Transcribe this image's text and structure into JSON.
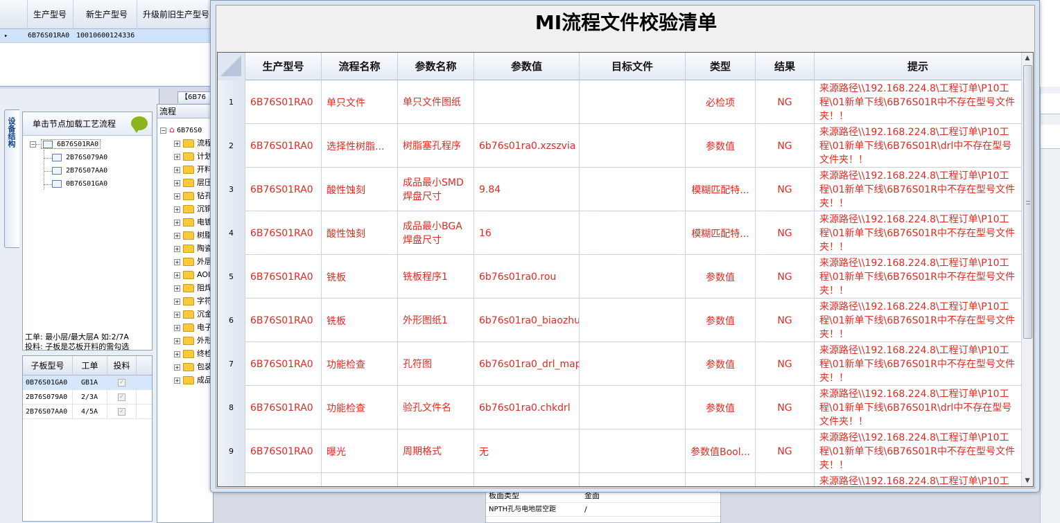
{
  "top_grid": {
    "headers": [
      "生产型号",
      "新生产型号",
      "升级前旧生产型号"
    ],
    "row": [
      "6B76S01RA0",
      "10010600124336"
    ]
  },
  "left": {
    "vertical_tab": "设备结构",
    "tree_header": "单击节点加载工艺流程",
    "root_node": "6B76S01RA0",
    "child_nodes": [
      "2B76S079A0",
      "2B76S07AA0",
      "0B76S01GA0"
    ],
    "info_line1": "工单: 最小层/最大层A 如:2/7A",
    "info_line2": "投料: 子板是芯板开料的需勾选",
    "sub_headers": [
      "子板型号",
      "工单",
      "投料"
    ],
    "sub_rows": [
      {
        "model": "0B76S01GA0",
        "order": "GB1A",
        "check": "✓"
      },
      {
        "model": "2B76S079A0",
        "order": "2/3A",
        "check": "✓"
      },
      {
        "model": "2B76S07AA0",
        "order": "4/5A",
        "check": "✓"
      }
    ]
  },
  "middle": {
    "tab_label": "【6B76",
    "header": "流程",
    "root": "6B76S0",
    "folders": [
      "流程",
      "计划",
      "开料",
      "层压",
      "钻孔",
      "沉铜",
      "电镀",
      "树脂",
      "陶瓷",
      "外层",
      "AOI",
      "阻焊",
      "字符",
      "沉金",
      "电子",
      "外形",
      "终检",
      "包装",
      "成品"
    ]
  },
  "bottom_grid": {
    "rows": [
      {
        "name": "板面类型",
        "value": "金面"
      },
      {
        "name": "NPTH孔与电地层空距",
        "value": "/"
      }
    ]
  },
  "dialog": {
    "title": "MI流程文件校验清单",
    "columns": [
      "生产型号",
      "流程名称",
      "参数名称",
      "参数值",
      "目标文件",
      "类型",
      "结果",
      "提示"
    ],
    "rows": [
      {
        "idx": "1",
        "model": "6B76S01RA0",
        "process": "单只文件",
        "param": "单只文件图纸",
        "value": "",
        "target": "",
        "type": "必检项",
        "result": "NG",
        "tip": "来源路径\\\\192.168.224.8\\工程订单\\P10工程\\01新单下线\\6B76S01R中不存在型号文件夹！！"
      },
      {
        "idx": "2",
        "model": "6B76S01RA0",
        "process": "选择性树脂...",
        "param": "树脂塞孔程序",
        "value": "6b76s01ra0.xzszvia",
        "target": "",
        "type": "参数值",
        "result": "NG",
        "tip": "来源路径\\\\192.168.224.8\\工程订单\\P10工程\\01新单下线\\6B76S01R\\drl中不存在型号文件夹！！"
      },
      {
        "idx": "3",
        "model": "6B76S01RA0",
        "process": "酸性蚀刻",
        "param": "成品最小SMD焊盘尺寸",
        "value": "9.84",
        "target": "",
        "type": "模糊匹配特...",
        "result": "NG",
        "tip": "来源路径\\\\192.168.224.8\\工程订单\\P10工程\\01新单下线\\6B76S01R中不存在型号文件夹！！"
      },
      {
        "idx": "4",
        "model": "6B76S01RA0",
        "process": "酸性蚀刻",
        "param": "成品最小BGA焊盘尺寸",
        "value": "16",
        "target": "",
        "type": "模糊匹配特...",
        "result": "NG",
        "tip": "来源路径\\\\192.168.224.8\\工程订单\\P10工程\\01新单下线\\6B76S01R中不存在型号文件夹！！"
      },
      {
        "idx": "5",
        "model": "6B76S01RA0",
        "process": "铣板",
        "param": "铣板程序1",
        "value": "6b76s01ra0.rou",
        "target": "",
        "type": "参数值",
        "result": "NG",
        "tip": "来源路径\\\\192.168.224.8\\工程订单\\P10工程\\01新单下线\\6B76S01R中不存在型号文件夹！！"
      },
      {
        "idx": "6",
        "model": "6B76S01RA0",
        "process": "铣板",
        "param": "外形图纸1",
        "value": "6b76s01ra0_biaozhu",
        "target": "",
        "type": "参数值",
        "result": "NG",
        "tip": "来源路径\\\\192.168.224.8\\工程订单\\P10工程\\01新单下线\\6B76S01R中不存在型号文件夹！！"
      },
      {
        "idx": "7",
        "model": "6B76S01RA0",
        "process": "功能检查",
        "param": "孔符图",
        "value": "6b76s01ra0_drl_map",
        "target": "",
        "type": "参数值",
        "result": "NG",
        "tip": "来源路径\\\\192.168.224.8\\工程订单\\P10工程\\01新单下线\\6B76S01R中不存在型号文件夹！！"
      },
      {
        "idx": "8",
        "model": "6B76S01RA0",
        "process": "功能检查",
        "param": "验孔文件名",
        "value": "6b76s01ra0.chkdrl",
        "target": "",
        "type": "参数值",
        "result": "NG",
        "tip": "来源路径\\\\192.168.224.8\\工程订单\\P10工程\\01新单下线\\6B76S01R\\drl中不存在型号文件夹！！"
      },
      {
        "idx": "9",
        "model": "6B76S01RA0",
        "process": "曝光",
        "param": "周期格式",
        "value": "无",
        "target": "",
        "type": "参数值Bool...",
        "result": "NG",
        "tip": "来源路径\\\\192.168.224.8\\工程订单\\P10工程\\01新单下线\\6B76S01R中不存在型号文件夹！！"
      },
      {
        "idx": "",
        "model": "",
        "process": "",
        "param": "",
        "value": "",
        "target": "",
        "type": "",
        "result": "",
        "tip": "来源路径\\\\192.168.224.8\\工程订单\\P10工"
      }
    ]
  }
}
